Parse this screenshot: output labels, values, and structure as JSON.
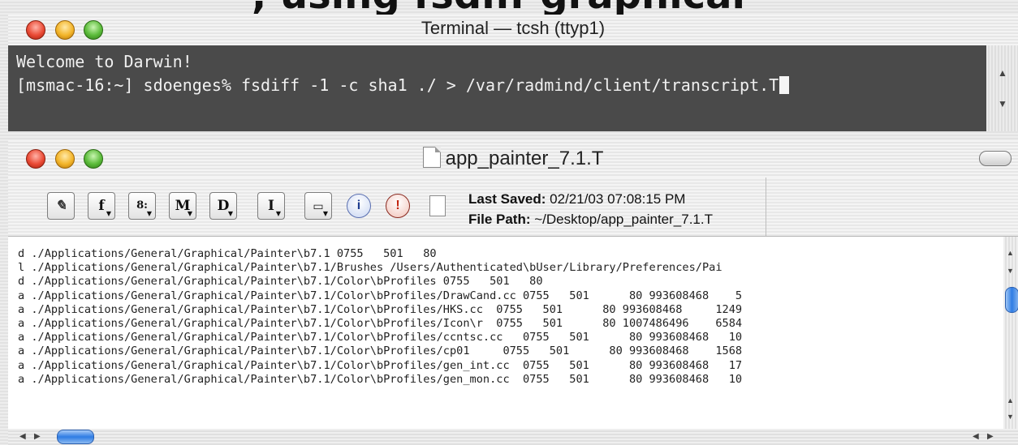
{
  "slide": {
    "title_fragment": ", using fsdiff graphical"
  },
  "terminal": {
    "title": "Terminal — tcsh (ttyp1)",
    "lines": [
      "Welcome to Darwin!",
      "[msmac-16:~] sdoenges% fsdiff -1 -c sha1 ./ > /var/radmind/client/transcript.T"
    ]
  },
  "document": {
    "title": "app_painter_7.1.T",
    "toolbar": {
      "buttons": [
        "pencil",
        "f",
        "s",
        "M",
        "D",
        "I",
        "folder",
        "info",
        "stop"
      ],
      "last_saved_label": "Last Saved:",
      "last_saved_value": "02/21/03 07:08:15 PM",
      "file_path_label": "File Path:",
      "file_path_value": "~/Desktop/app_painter_7.1.T"
    },
    "lines": [
      "d ./Applications/General/Graphical/Painter\\b7.1 0755   501   80",
      "l ./Applications/General/Graphical/Painter\\b7.1/Brushes /Users/Authenticated\\bUser/Library/Preferences/Pai",
      "d ./Applications/General/Graphical/Painter\\b7.1/Color\\bProfiles 0755   501   80",
      "a ./Applications/General/Graphical/Painter\\b7.1/Color\\bProfiles/DrawCand.cc 0755   501      80 993608468    5",
      "a ./Applications/General/Graphical/Painter\\b7.1/Color\\bProfiles/HKS.cc  0755   501      80 993608468     1249",
      "a ./Applications/General/Graphical/Painter\\b7.1/Color\\bProfiles/Icon\\r  0755   501      80 1007486496    6584",
      "a ./Applications/General/Graphical/Painter\\b7.1/Color\\bProfiles/ccntsc.cc   0755   501      80 993608468   10",
      "a ./Applications/General/Graphical/Painter\\b7.1/Color\\bProfiles/cp01     0755   501      80 993608468    1568",
      "a ./Applications/General/Graphical/Painter\\b7.1/Color\\bProfiles/gen_int.cc  0755   501      80 993608468   17",
      "a ./Applications/General/Graphical/Painter\\b7.1/Color\\bProfiles/gen_mon.cc  0755   501      80 993608468   10"
    ]
  }
}
